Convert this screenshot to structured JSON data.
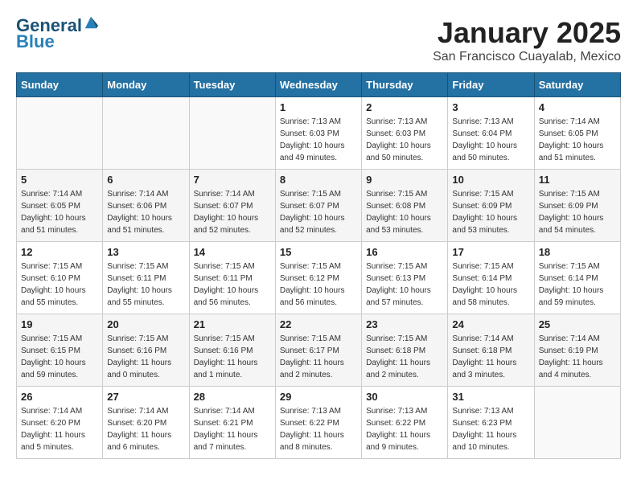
{
  "logo": {
    "line1": "General",
    "line2": "Blue"
  },
  "title": "January 2025",
  "subtitle": "San Francisco Cuayalab, Mexico",
  "days_of_week": [
    "Sunday",
    "Monday",
    "Tuesday",
    "Wednesday",
    "Thursday",
    "Friday",
    "Saturday"
  ],
  "weeks": [
    [
      {
        "day": "",
        "info": ""
      },
      {
        "day": "",
        "info": ""
      },
      {
        "day": "",
        "info": ""
      },
      {
        "day": "1",
        "info": "Sunrise: 7:13 AM\nSunset: 6:03 PM\nDaylight: 10 hours\nand 49 minutes."
      },
      {
        "day": "2",
        "info": "Sunrise: 7:13 AM\nSunset: 6:03 PM\nDaylight: 10 hours\nand 50 minutes."
      },
      {
        "day": "3",
        "info": "Sunrise: 7:13 AM\nSunset: 6:04 PM\nDaylight: 10 hours\nand 50 minutes."
      },
      {
        "day": "4",
        "info": "Sunrise: 7:14 AM\nSunset: 6:05 PM\nDaylight: 10 hours\nand 51 minutes."
      }
    ],
    [
      {
        "day": "5",
        "info": "Sunrise: 7:14 AM\nSunset: 6:05 PM\nDaylight: 10 hours\nand 51 minutes."
      },
      {
        "day": "6",
        "info": "Sunrise: 7:14 AM\nSunset: 6:06 PM\nDaylight: 10 hours\nand 51 minutes."
      },
      {
        "day": "7",
        "info": "Sunrise: 7:14 AM\nSunset: 6:07 PM\nDaylight: 10 hours\nand 52 minutes."
      },
      {
        "day": "8",
        "info": "Sunrise: 7:15 AM\nSunset: 6:07 PM\nDaylight: 10 hours\nand 52 minutes."
      },
      {
        "day": "9",
        "info": "Sunrise: 7:15 AM\nSunset: 6:08 PM\nDaylight: 10 hours\nand 53 minutes."
      },
      {
        "day": "10",
        "info": "Sunrise: 7:15 AM\nSunset: 6:09 PM\nDaylight: 10 hours\nand 53 minutes."
      },
      {
        "day": "11",
        "info": "Sunrise: 7:15 AM\nSunset: 6:09 PM\nDaylight: 10 hours\nand 54 minutes."
      }
    ],
    [
      {
        "day": "12",
        "info": "Sunrise: 7:15 AM\nSunset: 6:10 PM\nDaylight: 10 hours\nand 55 minutes."
      },
      {
        "day": "13",
        "info": "Sunrise: 7:15 AM\nSunset: 6:11 PM\nDaylight: 10 hours\nand 55 minutes."
      },
      {
        "day": "14",
        "info": "Sunrise: 7:15 AM\nSunset: 6:11 PM\nDaylight: 10 hours\nand 56 minutes."
      },
      {
        "day": "15",
        "info": "Sunrise: 7:15 AM\nSunset: 6:12 PM\nDaylight: 10 hours\nand 56 minutes."
      },
      {
        "day": "16",
        "info": "Sunrise: 7:15 AM\nSunset: 6:13 PM\nDaylight: 10 hours\nand 57 minutes."
      },
      {
        "day": "17",
        "info": "Sunrise: 7:15 AM\nSunset: 6:14 PM\nDaylight: 10 hours\nand 58 minutes."
      },
      {
        "day": "18",
        "info": "Sunrise: 7:15 AM\nSunset: 6:14 PM\nDaylight: 10 hours\nand 59 minutes."
      }
    ],
    [
      {
        "day": "19",
        "info": "Sunrise: 7:15 AM\nSunset: 6:15 PM\nDaylight: 10 hours\nand 59 minutes."
      },
      {
        "day": "20",
        "info": "Sunrise: 7:15 AM\nSunset: 6:16 PM\nDaylight: 11 hours\nand 0 minutes."
      },
      {
        "day": "21",
        "info": "Sunrise: 7:15 AM\nSunset: 6:16 PM\nDaylight: 11 hours\nand 1 minute."
      },
      {
        "day": "22",
        "info": "Sunrise: 7:15 AM\nSunset: 6:17 PM\nDaylight: 11 hours\nand 2 minutes."
      },
      {
        "day": "23",
        "info": "Sunrise: 7:15 AM\nSunset: 6:18 PM\nDaylight: 11 hours\nand 2 minutes."
      },
      {
        "day": "24",
        "info": "Sunrise: 7:14 AM\nSunset: 6:18 PM\nDaylight: 11 hours\nand 3 minutes."
      },
      {
        "day": "25",
        "info": "Sunrise: 7:14 AM\nSunset: 6:19 PM\nDaylight: 11 hours\nand 4 minutes."
      }
    ],
    [
      {
        "day": "26",
        "info": "Sunrise: 7:14 AM\nSunset: 6:20 PM\nDaylight: 11 hours\nand 5 minutes."
      },
      {
        "day": "27",
        "info": "Sunrise: 7:14 AM\nSunset: 6:20 PM\nDaylight: 11 hours\nand 6 minutes."
      },
      {
        "day": "28",
        "info": "Sunrise: 7:14 AM\nSunset: 6:21 PM\nDaylight: 11 hours\nand 7 minutes."
      },
      {
        "day": "29",
        "info": "Sunrise: 7:13 AM\nSunset: 6:22 PM\nDaylight: 11 hours\nand 8 minutes."
      },
      {
        "day": "30",
        "info": "Sunrise: 7:13 AM\nSunset: 6:22 PM\nDaylight: 11 hours\nand 9 minutes."
      },
      {
        "day": "31",
        "info": "Sunrise: 7:13 AM\nSunset: 6:23 PM\nDaylight: 11 hours\nand 10 minutes."
      },
      {
        "day": "",
        "info": ""
      }
    ]
  ]
}
